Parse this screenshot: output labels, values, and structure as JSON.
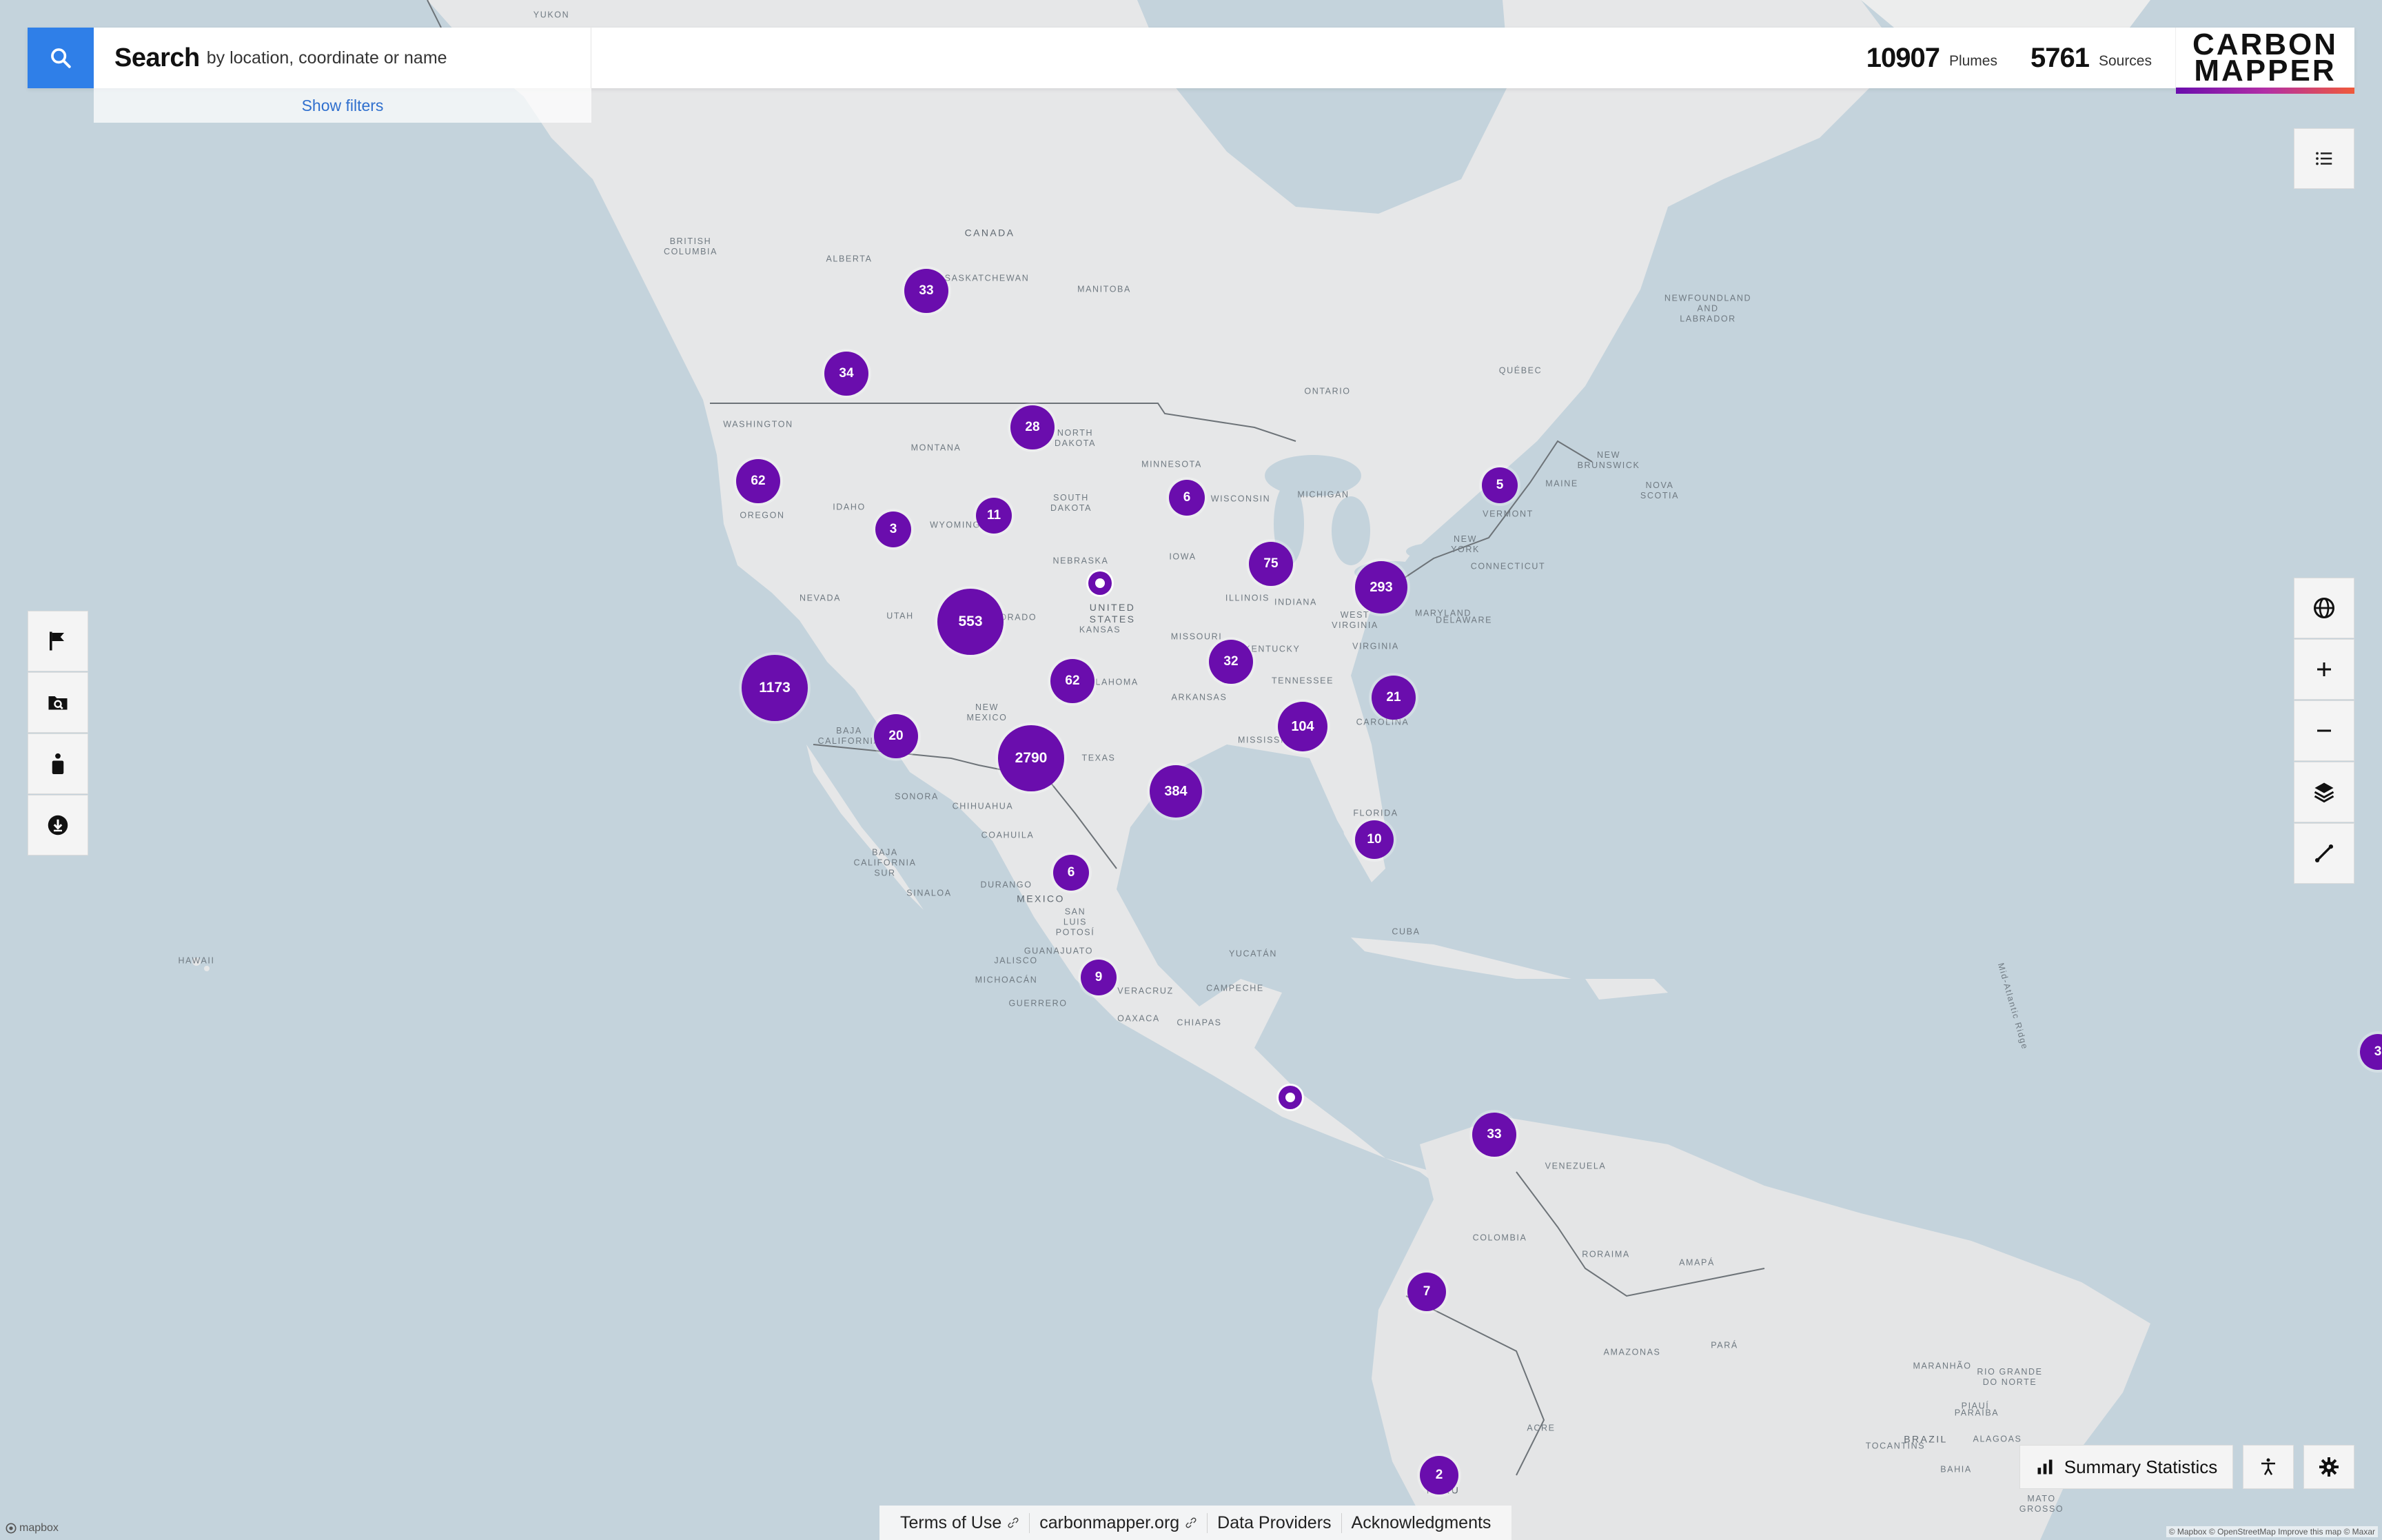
{
  "search": {
    "title": "Search",
    "hint": "by location, coordinate or name",
    "show_filters": "Show filters"
  },
  "stats": {
    "plumes_count": "10907",
    "plumes_label": "Plumes",
    "sources_count": "5761",
    "sources_label": "Sources"
  },
  "logo": {
    "text": "CARBON\nMAPPER"
  },
  "colors": {
    "cluster": "#6a0dad",
    "search_button": "#2f7fe8",
    "link": "#2f6fce"
  },
  "left_tools": [
    {
      "name": "flag-icon"
    },
    {
      "name": "image-search-icon"
    },
    {
      "name": "person-icon"
    },
    {
      "name": "download-icon"
    }
  ],
  "right_tools": [
    {
      "name": "globe-icon"
    },
    {
      "name": "zoom-in-icon"
    },
    {
      "name": "zoom-out-icon"
    },
    {
      "name": "layers-icon"
    },
    {
      "name": "measure-icon"
    }
  ],
  "bottom": {
    "summary_label": "Summary Statistics"
  },
  "footer": {
    "links": [
      "Terms of Use",
      "carbonmapper.org",
      "Data Providers",
      "Acknowledgments"
    ]
  },
  "attribution": {
    "mapbox": "mapbox",
    "credits": "© Mapbox © OpenStreetMap Improve this map © Maxar"
  },
  "map_labels": [
    {
      "text": "CANADA",
      "type": "country"
    },
    {
      "text": "ALBERTA"
    },
    {
      "text": "SASKATCHEWAN"
    },
    {
      "text": "MANITOBA"
    },
    {
      "text": "BRITISH\nCOLUMBIA"
    },
    {
      "text": "ONTARIO"
    },
    {
      "text": "QUÉBEC"
    },
    {
      "text": "NEWFOUNDLAND\nAND\nLABRADOR"
    },
    {
      "text": "WASHINGTON"
    },
    {
      "text": "MONTANA"
    },
    {
      "text": "NORTH\nDAKOTA"
    },
    {
      "text": "SOUTH\nDAKOTA"
    },
    {
      "text": "MINNESOTA"
    },
    {
      "text": "WISCONSIN"
    },
    {
      "text": "MICHIGAN"
    },
    {
      "text": "OREGON"
    },
    {
      "text": "IDAHO"
    },
    {
      "text": "WYOMING"
    },
    {
      "text": "NEBRASKA"
    },
    {
      "text": "IOWA"
    },
    {
      "text": "NEVADA"
    },
    {
      "text": "UTAH"
    },
    {
      "text": "COLORADO"
    },
    {
      "text": "UNITED\nSTATES",
      "type": "country"
    },
    {
      "text": "KANSAS"
    },
    {
      "text": "MISSOURI"
    },
    {
      "text": "ILLINOIS"
    },
    {
      "text": "INDIANA"
    },
    {
      "text": "KENTUCKY"
    },
    {
      "text": "VIRGINIA"
    },
    {
      "text": "WEST\nVIRGINIA"
    },
    {
      "text": "MARYLAND"
    },
    {
      "text": "DELAWARE"
    },
    {
      "text": "NEW\nYORK"
    },
    {
      "text": "VERMONT"
    },
    {
      "text": "MAINE"
    },
    {
      "text": "CONNECTICUT"
    },
    {
      "text": "NEW\nBRUNSWICK"
    },
    {
      "text": "NOVA\nSCOTIA"
    },
    {
      "text": "OKLAHOMA"
    },
    {
      "text": "ARKANSAS"
    },
    {
      "text": "TENNESSEE"
    },
    {
      "text": "MISSISSIPPI"
    },
    {
      "text": "CAROLINA"
    },
    {
      "text": "FLORIDA"
    },
    {
      "text": "NEW\nMEXICO"
    },
    {
      "text": "TEXAS"
    },
    {
      "text": "BAJA\nCALIFORNIA"
    },
    {
      "text": "SONORA"
    },
    {
      "text": "CHIHUAHUA"
    },
    {
      "text": "COAHUILA"
    },
    {
      "text": "BAJA\nCALIFORNIA\nSUR"
    },
    {
      "text": "SINALOA"
    },
    {
      "text": "DURANGO"
    },
    {
      "text": "MEXICO",
      "type": "country"
    },
    {
      "text": "SAN\nLUIS\nPOTOSÍ"
    },
    {
      "text": "JALISCO"
    },
    {
      "text": "GUANAJUATO"
    },
    {
      "text": "MICHOACÁN"
    },
    {
      "text": "GUERRERO"
    },
    {
      "text": "OAXACA"
    },
    {
      "text": "VERACRUZ"
    },
    {
      "text": "CAMPECHE"
    },
    {
      "text": "YUCATÁN"
    },
    {
      "text": "CHIAPAS"
    },
    {
      "text": "CUBA"
    },
    {
      "text": "HAWAII"
    },
    {
      "text": "VENEZUELA"
    },
    {
      "text": "COLOMBIA"
    },
    {
      "text": "RORAIMA"
    },
    {
      "text": "AMAPÁ"
    },
    {
      "text": "AMAZONAS"
    },
    {
      "text": "PARÁ"
    },
    {
      "text": "MARANHÃO"
    },
    {
      "text": "PIAUÍ"
    },
    {
      "text": "RIO GRANDE\nDO NORTE"
    },
    {
      "text": "PARAÍBA"
    },
    {
      "text": "ALAGOAS"
    },
    {
      "text": "BRAZIL",
      "type": "country"
    },
    {
      "text": "TOCANTINS"
    },
    {
      "text": "ACRE"
    },
    {
      "text": "PERU",
      "type": "country"
    },
    {
      "text": "MATO\nGROSSO"
    },
    {
      "text": "BAHIA"
    },
    {
      "text": "YUKON"
    },
    {
      "text": "Mid-Atlantic Ridge"
    }
  ],
  "clusters": [
    {
      "count": 33
    },
    {
      "count": 34
    },
    {
      "count": 28
    },
    {
      "count": 62
    },
    {
      "count": 3
    },
    {
      "count": 11
    },
    {
      "count": 6
    },
    {
      "count": 5
    },
    {
      "count": 75
    },
    {
      "count": 293
    },
    {
      "count": 553
    },
    {
      "count": 1173
    },
    {
      "count": 62
    },
    {
      "count": 32
    },
    {
      "count": 21
    },
    {
      "count": 104
    },
    {
      "count": 20
    },
    {
      "count": 2790
    },
    {
      "count": 384
    },
    {
      "count": 10
    },
    {
      "count": 6
    },
    {
      "count": 9
    },
    {
      "count": 33
    },
    {
      "count": 7
    },
    {
      "count": 2
    },
    {
      "count": 3
    }
  ],
  "pins": [
    {
      "name": "single-source-pin"
    },
    {
      "name": "single-source-pin"
    }
  ]
}
